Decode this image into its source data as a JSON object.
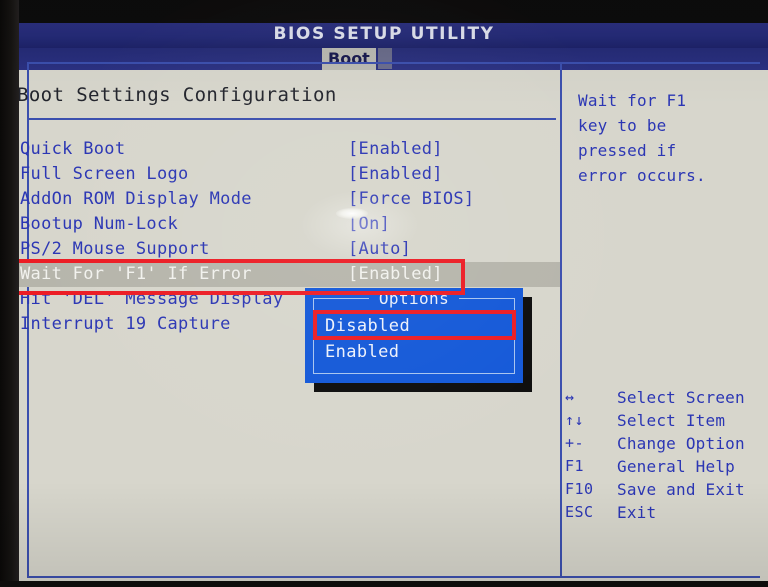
{
  "window": {
    "title": "BIOS SETUP UTILITY"
  },
  "tabs": {
    "active": "Boot"
  },
  "main": {
    "section_title": "Boot Settings Configuration",
    "settings": [
      {
        "label": "Quick Boot",
        "value": "[Enabled]"
      },
      {
        "label": "Full Screen Logo",
        "value": "[Enabled]"
      },
      {
        "label": "AddOn ROM Display Mode",
        "value": "[Force BIOS]"
      },
      {
        "label": "Bootup Num-Lock",
        "value": "[On]"
      },
      {
        "label": "PS/2 Mouse Support",
        "value": "[Auto]"
      },
      {
        "label": "Wait For 'F1' If Error",
        "value": "[Enabled]"
      },
      {
        "label": "Hit 'DEL' Message Display",
        "value": ""
      },
      {
        "label": "Interrupt 19 Capture",
        "value": ""
      }
    ]
  },
  "popup": {
    "title": "Options",
    "options": [
      {
        "label": "Disabled"
      },
      {
        "label": "Enabled"
      }
    ]
  },
  "help": {
    "lines": [
      "Wait for F1",
      "key to be",
      "pressed if",
      "error occurs."
    ]
  },
  "legend": {
    "items": [
      {
        "key": "↔",
        "desc": "Select Screen"
      },
      {
        "key": "↑↓",
        "desc": "Select Item"
      },
      {
        "key": "+-",
        "desc": "Change Option"
      },
      {
        "key": "F1",
        "desc": "General Help"
      },
      {
        "key": "F10",
        "desc": "Save and Exit"
      },
      {
        "key": "ESC",
        "desc": "Exit"
      }
    ]
  },
  "colors": {
    "title_bar": "#242a77",
    "text_blue": "#2b36b4",
    "panel_bg": "#d7d6cc",
    "popup_bg": "#1358d8",
    "selected_row_bg": "#b6b5ab",
    "annotation_red": "#ec1c24"
  }
}
